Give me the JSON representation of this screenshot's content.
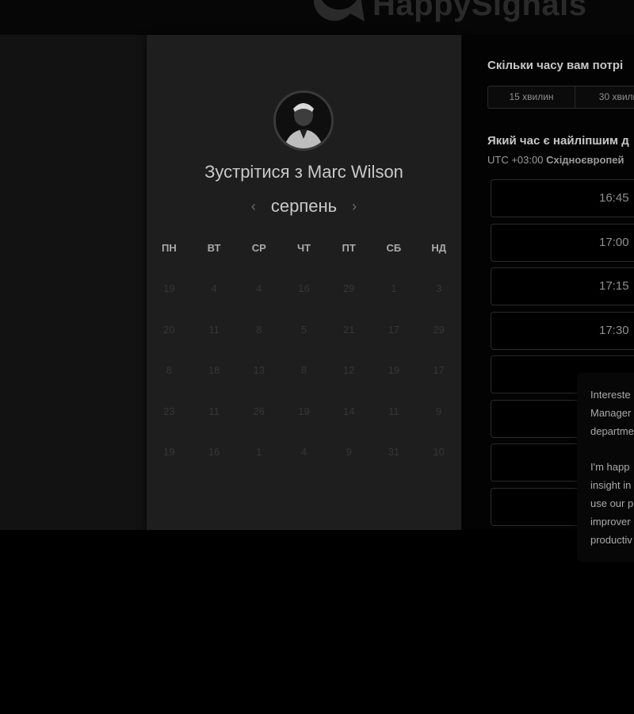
{
  "brand": {
    "name": "HappySignals"
  },
  "colors": {
    "background": "#000000",
    "card": "#1e1e1e",
    "panel": "#030303",
    "text": "#c9c9c9"
  },
  "calendar": {
    "title": "Зустрітися з Marc Wilson",
    "month": "серпень",
    "prev_icon": "‹",
    "next_icon": "›",
    "weekdays": [
      "ПН",
      "ВТ",
      "СР",
      "ЧТ",
      "ПТ",
      "СБ",
      "НД"
    ],
    "weeks": [
      [
        "19",
        "4",
        "4",
        "16",
        "29",
        "1",
        "3"
      ],
      [
        "20",
        "11",
        "8",
        "5",
        "21",
        "17",
        "29"
      ],
      [
        "8",
        "18",
        "13",
        "8",
        "12",
        "19",
        "17"
      ],
      [
        "23",
        "11",
        "26",
        "19",
        "14",
        "11",
        "9"
      ],
      [
        "19",
        "16",
        "1",
        "4",
        "9",
        "31",
        "10"
      ]
    ]
  },
  "booking": {
    "duration_question": "Скільки часу вам потрі",
    "durations": [
      "15 хвилин",
      "30 хвили"
    ],
    "time_question": "Який час є найліпшим д",
    "timezone_offset": "UTC +03:00",
    "timezone_name": "Східноєвропей",
    "slots": [
      "16:45",
      "17:00",
      "17:15",
      "17:30",
      "",
      "",
      "",
      ""
    ]
  },
  "chat": {
    "paragraph1": [
      "Intereste",
      "Manager",
      "departme"
    ],
    "paragraph2": [
      "I'm happ",
      "insight in",
      "use our p",
      "improver",
      "productiv"
    ]
  }
}
